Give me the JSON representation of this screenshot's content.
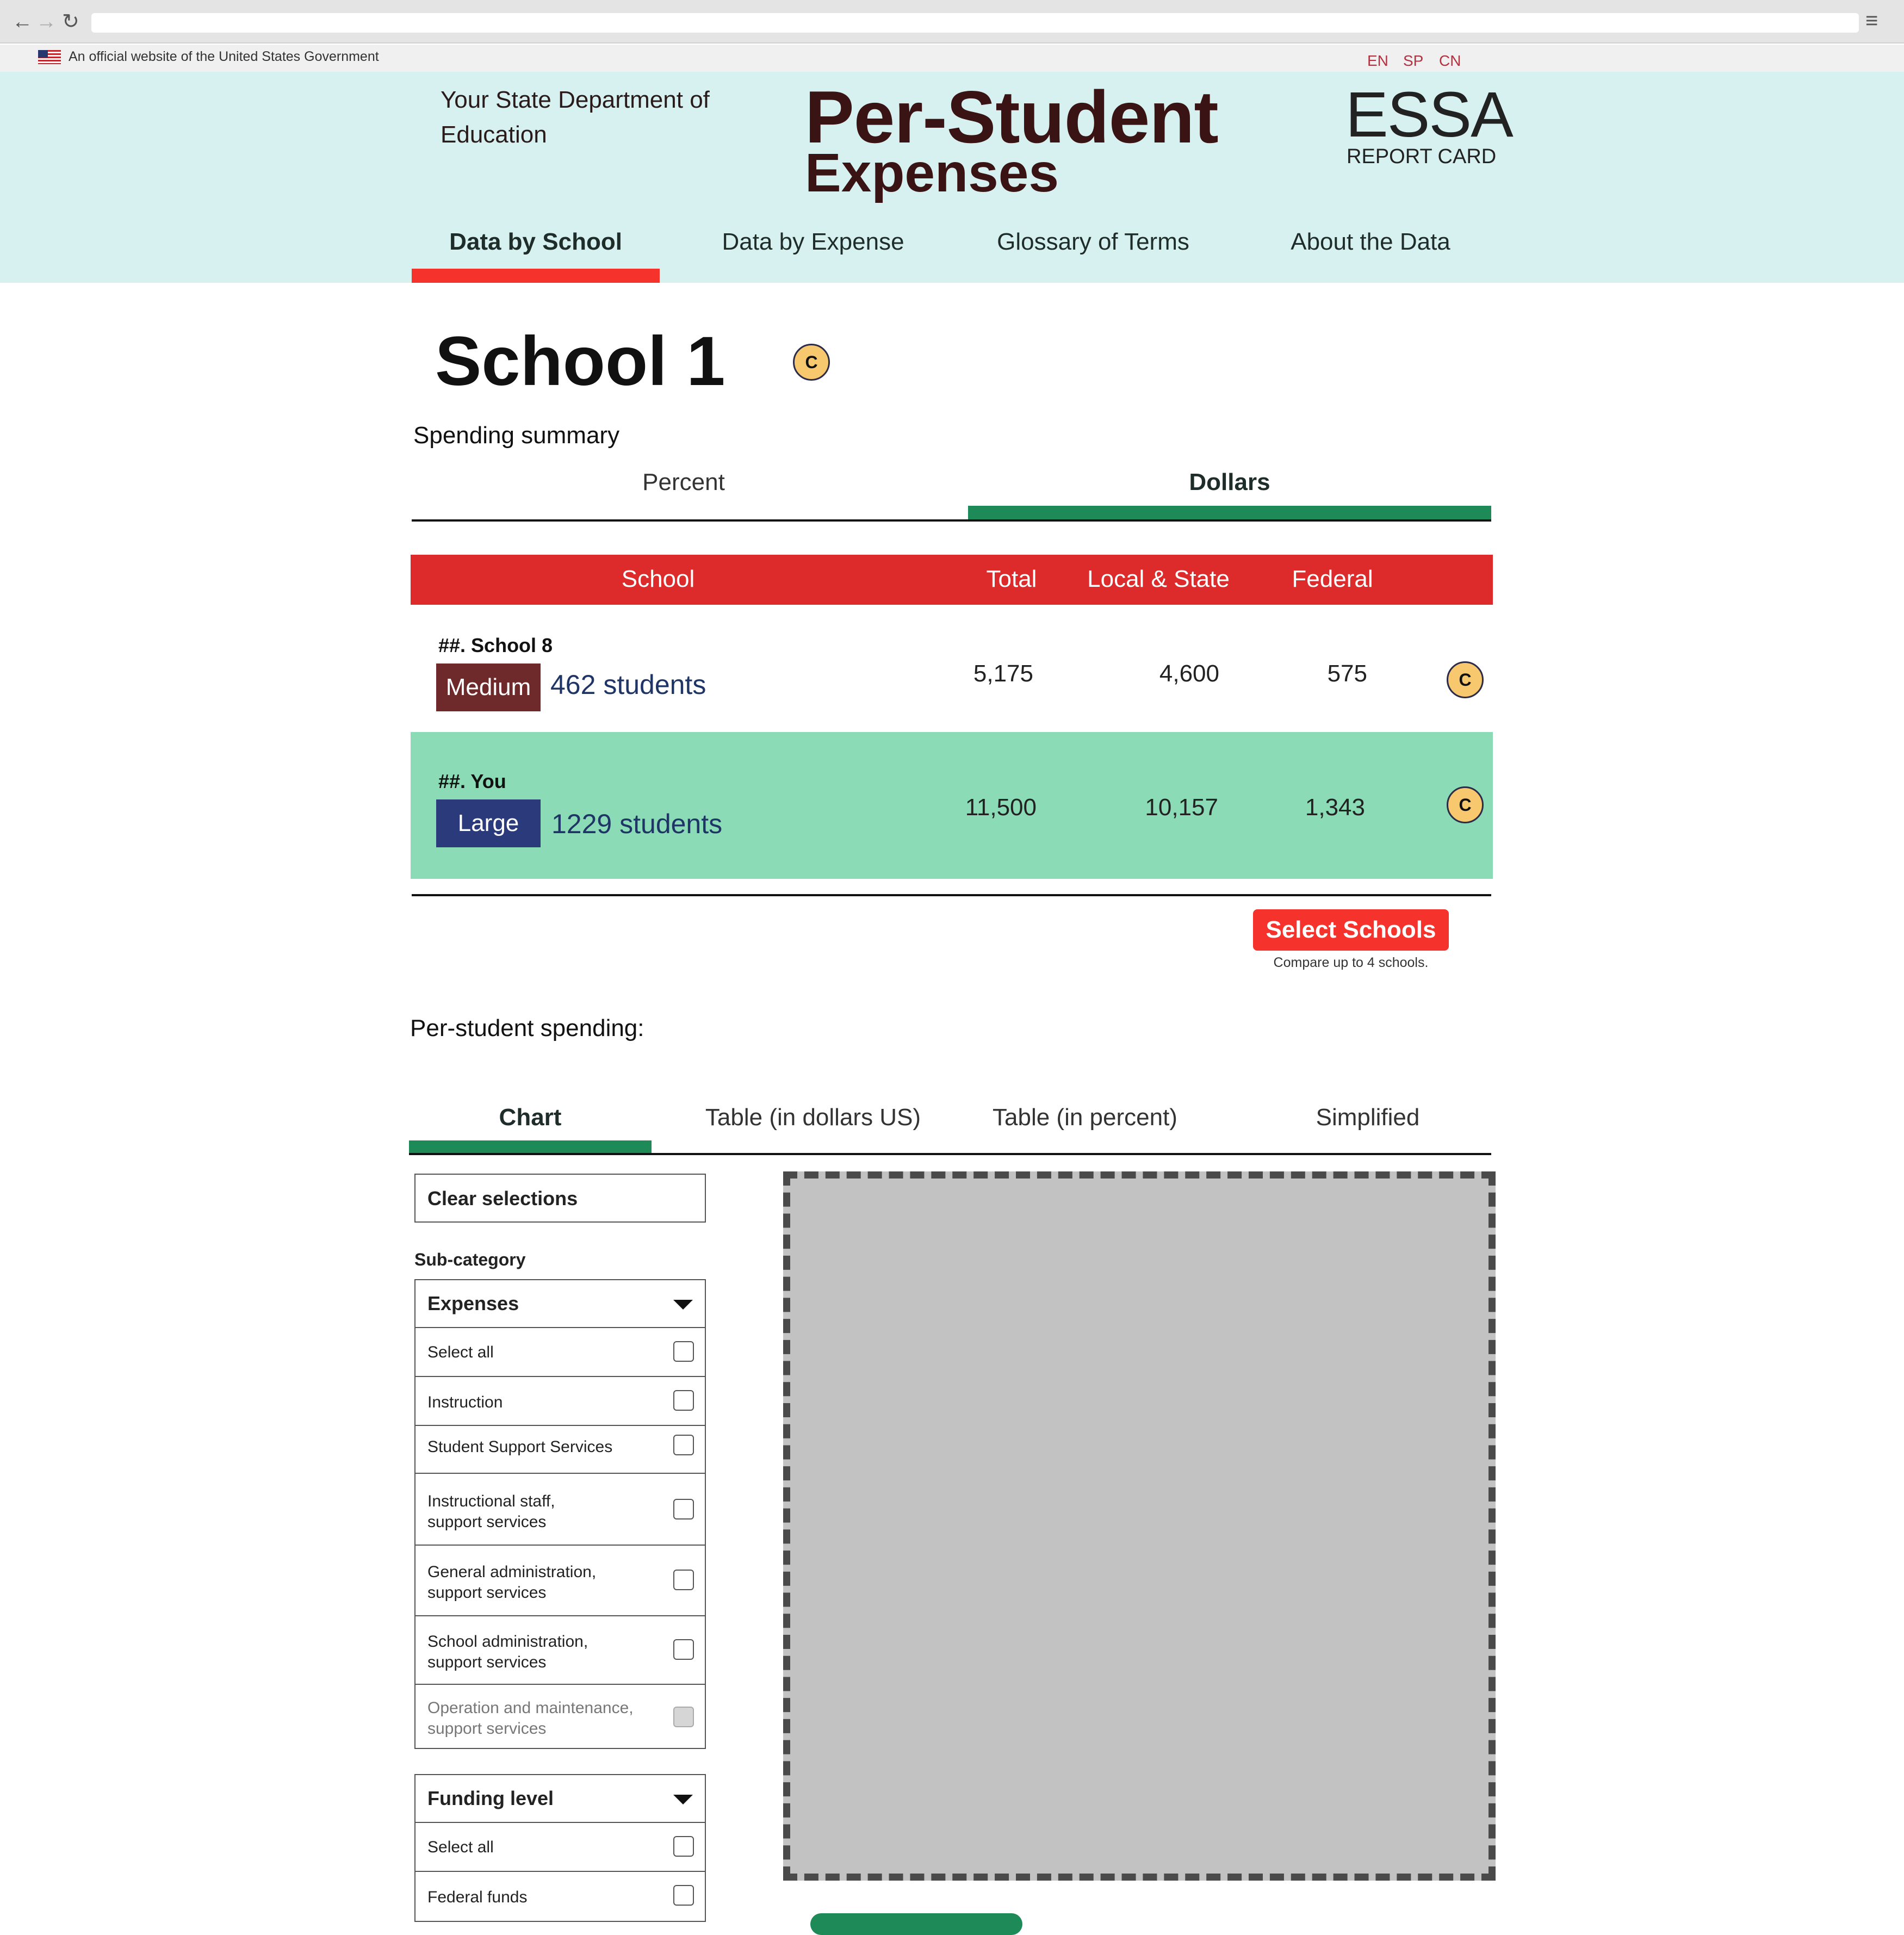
{
  "browser": {
    "back_icon": "back-arrow-icon",
    "forward_icon": "forward-arrow-icon",
    "reload_icon": "reload-icon",
    "menu_icon": "hamburger-menu-icon"
  },
  "gov_banner": {
    "text": "An official website of the United States Government",
    "languages": [
      "EN",
      "SP",
      "CN"
    ]
  },
  "header": {
    "agency": "Your State Department of Education",
    "title_line1": "Per-Student",
    "title_line2": "Expenses",
    "logo_line1": "ESSA",
    "logo_line2": "REPORT CARD",
    "nav": [
      "Data by School",
      "Data by Expense",
      "Glossary of Terms",
      "About the Data"
    ],
    "active_nav": "Data by School"
  },
  "school": {
    "name": "School 1",
    "badge": "C"
  },
  "spending_summary": {
    "label": "Spending summary",
    "tabs": [
      "Percent",
      "Dollars"
    ],
    "active_tab": "Dollars",
    "columns": [
      "School",
      "Total",
      "Local & State",
      "Federal"
    ],
    "rows": [
      {
        "name": "##. School 8",
        "size": "Medium",
        "students": "462 students",
        "total": "5,175",
        "local_state": "4,600",
        "federal": "575",
        "badge": "C"
      },
      {
        "name": "##. You",
        "size": "Large",
        "students": "1229 students",
        "total": "11,500",
        "local_state": "10,157",
        "federal": "1,343",
        "badge": "C"
      }
    ],
    "select_button": "Select Schools",
    "compare_note": "Compare up to 4 schools."
  },
  "per_student": {
    "label": "Per-student spending:",
    "tabs": [
      "Chart",
      "Table (in dollars US)",
      "Table (in percent)",
      "Simplified"
    ],
    "active_tab": "Chart"
  },
  "filters": {
    "clear_label": "Clear selections",
    "subcategory_label": "Sub-category",
    "expenses": {
      "label": "Expenses",
      "options": [
        "Select all",
        "Instruction",
        "Student Support Services",
        "Instructional staff, support services",
        "General administration, support services",
        "School administration, support services",
        "Operation and maintenance, support services"
      ]
    },
    "funding": {
      "label": "Funding level",
      "options": [
        "Select all",
        "Federal funds"
      ]
    }
  },
  "colors": {
    "header_bg": "#d6f1ef",
    "accent_red": "#f5322b",
    "table_head": "#dd2a2a",
    "accent_green": "#1d8a57",
    "highlight_row": "#8bdcb6",
    "medium_badge": "#6e2a2a",
    "large_badge": "#2a3a7a",
    "badge_yellow": "#f7c86d"
  }
}
